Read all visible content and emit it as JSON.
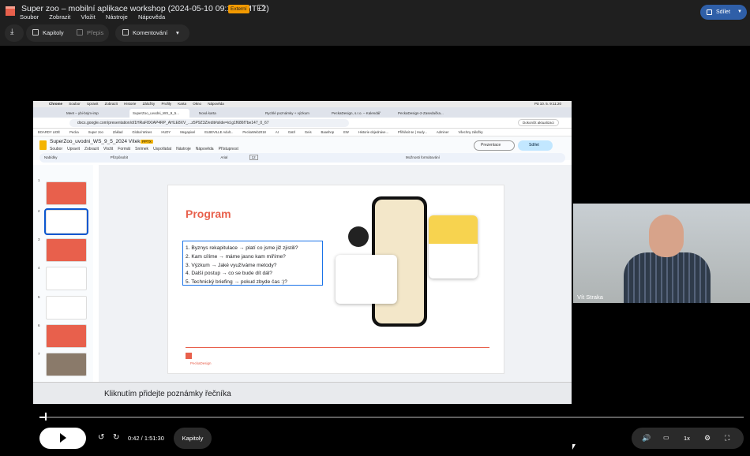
{
  "app": {
    "title": "Super zoo – mobilní aplikace workshop (2024-05-10 09:10 GMT+2)",
    "badge": "Externí",
    "menus": [
      "Soubor",
      "Zobrazit",
      "Vložit",
      "Nástroje",
      "Nápověda"
    ],
    "share_label": "Sdílet"
  },
  "toolbar": {
    "chapters_label": "Kapitoly",
    "transcript_label": "Přepis",
    "comment_label": "Komentování"
  },
  "screen": {
    "mac_menu": [
      "Chrome",
      "Soubor",
      "Upravit",
      "Zobrazit",
      "Historie",
      "Záložky",
      "Profily",
      "Karta",
      "Okno",
      "Nápověda"
    ],
    "mac_status": "Pá 10. 5. 9:11:20",
    "tabs": [
      "Meet – ybi-bnjm-imp",
      "SuperZoo_uvodni_WS_9_5...",
      "Nová karta",
      "Rychlé poznámky + výzkum",
      "PeckaDesign, s.r.o. – Kalendář",
      "PeckaDesign-2-Zasedačka..."
    ],
    "url": "docs.google.com/presentation/d/1HRaF8XIAP4RP_AHLE8XV_...z5P9Z3Z/edit#slide=id.g1f686f7be147_0_67",
    "update_label": "Dokončit aktualizaci",
    "bookmarks": [
      "BOARDY LIDÉ",
      "Pecka",
      "Super zoo",
      "Základ",
      "Global Wines",
      "HUDY",
      "Megapixel",
      "ELBEVILLE Adult...",
      "PeckaWeb2018",
      "AI",
      "Gatrl",
      "Geis",
      "Baashop",
      "EW",
      "Historie objednáve...",
      "Přihlásit se | Hudy...",
      "Adminer",
      "Všechny záložky"
    ],
    "slides_title": "SuperZoo_uvodni_WS_9_5_2024 Vítek",
    "slides_badge": "PPTX",
    "slides_menus": [
      "Soubor",
      "Upravit",
      "Zobrazit",
      "Vložit",
      "Formát",
      "Snímek",
      "Uspořádat",
      "Nástroje",
      "Nápověda",
      "Přístupnost"
    ],
    "present_label": "Prezentace",
    "slides_share": "Sdílet",
    "slides_toolbar": [
      "Nabídky",
      "Přizpůsobit",
      "Arial",
      "12",
      "Možnosti formátování"
    ],
    "thumb_numbers": [
      "1",
      "2",
      "3",
      "4",
      "5",
      "6",
      "7",
      "8"
    ],
    "slide_title": "Program",
    "agenda": [
      "1.  Byznys rekapitulace → platí co jsme již zjistili?",
      "2.  Kam cílíme → máme jasno kam míříme?",
      "3.  Výzkum → Jaké využíváme metody?",
      "4.  Další postup → co se bude dít dál?",
      "5.  Technický briefing → pokud zbyde čas :)?"
    ],
    "logo_text": "PeckaDesign",
    "notes_placeholder": "Kliknutím přidejte poznámky řečníka"
  },
  "camera": {
    "name": "Vít Straka"
  },
  "player": {
    "progress": 0.008,
    "time": "0:42 / 1:51:30",
    "chapters_label": "Kapitoly",
    "speed": "1x"
  }
}
